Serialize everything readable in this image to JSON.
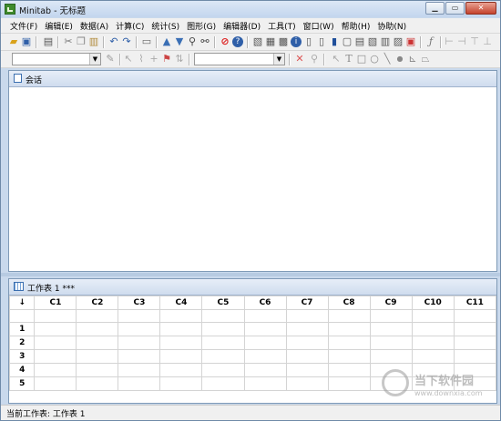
{
  "window": {
    "title": "Minitab - 无标题"
  },
  "menubar": {
    "items": [
      "文件(F)",
      "编辑(E)",
      "数据(A)",
      "计算(C)",
      "统计(S)",
      "图形(G)",
      "编辑器(D)",
      "工具(T)",
      "窗口(W)",
      "帮助(H)",
      "协助(N)"
    ]
  },
  "session": {
    "title": "会话"
  },
  "worksheet": {
    "title": "工作表 1 ***",
    "corner": "↓",
    "columns": [
      "C1",
      "C2",
      "C3",
      "C4",
      "C5",
      "C6",
      "C7",
      "C8",
      "C9",
      "C10",
      "C11"
    ],
    "rows": [
      "1",
      "2",
      "3",
      "4",
      "5"
    ]
  },
  "status": {
    "text": "当前工作表: 工作表 1"
  },
  "watermark": {
    "title": "当下软件园",
    "url": "www.downxia.com"
  },
  "colors": {
    "title_bar": "#c3d6ee",
    "pane_border": "#7f9ab7",
    "app_icon": "#3e8a2c"
  }
}
